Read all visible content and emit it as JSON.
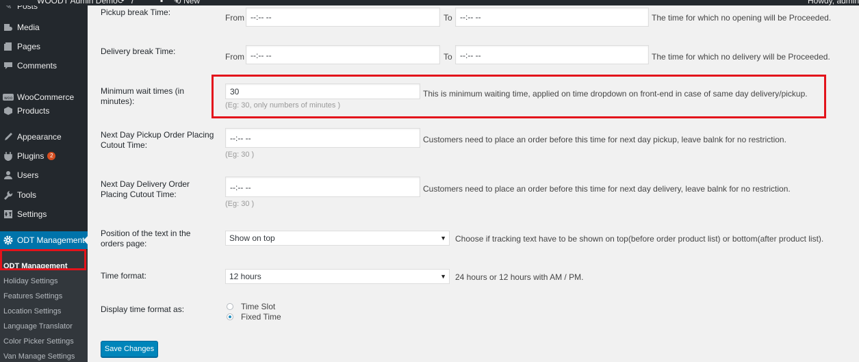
{
  "adminbar": {
    "site_name": "WOODT Admin Demo",
    "updates_count": "7",
    "comments_count": "0",
    "new_label": "New",
    "howdy": "Howdy, admin"
  },
  "sidebar": {
    "items": [
      {
        "label": "Posts",
        "icon": "pin-icon"
      },
      {
        "label": "Media",
        "icon": "media-icon"
      },
      {
        "label": "Pages",
        "icon": "pages-icon"
      },
      {
        "label": "Comments",
        "icon": "comments-icon"
      },
      {
        "label": "WooCommerce",
        "icon": "woocommerce-icon"
      },
      {
        "label": "Products",
        "icon": "products-icon"
      },
      {
        "label": "Appearance",
        "icon": "appearance-icon"
      },
      {
        "label": "Plugins",
        "icon": "plugins-icon",
        "badge": "2"
      },
      {
        "label": "Users",
        "icon": "users-icon"
      },
      {
        "label": "Tools",
        "icon": "tools-icon"
      },
      {
        "label": "Settings",
        "icon": "settings-icon"
      },
      {
        "label": "ODT Management",
        "icon": "gear-icon",
        "active": true
      }
    ],
    "submenu": [
      "ODT Management",
      "Holiday Settings",
      "Features Settings",
      "Location Settings",
      "Language Translator",
      "Color Picker Settings",
      "Van Manage Settings"
    ]
  },
  "form": {
    "pickup_break": {
      "label": "Pickup break Time:",
      "from_label": "From",
      "to_label": "To",
      "from_value": "--:-- --",
      "to_value": "--:-- --",
      "desc": "The time for which no opening will be Proceeded."
    },
    "delivery_break": {
      "label": "Delivery break Time:",
      "from_label": "From",
      "to_label": "To",
      "from_value": "--:-- --",
      "to_value": "--:-- --",
      "desc": "The time for which no delivery will be Proceeded."
    },
    "min_wait": {
      "label": "Minimum wait times (in minutes):",
      "value": "30",
      "desc": "This is minimum waiting time, applied on time dropdown on front-end in case of same day delivery/pickup.",
      "hint": "(Eg: 30, only numbers of minutes )"
    },
    "next_day_pickup": {
      "label": "Next Day Pickup Order Placing Cutout Time:",
      "value": "--:-- --",
      "desc": "Customers need to place an order before this time for next day pickup, leave balnk for no restriction.",
      "hint": "(Eg: 30 )"
    },
    "next_day_delivery": {
      "label": "Next Day Delivery Order Placing Cutout Time:",
      "value": "--:-- --",
      "desc": "Customers need to place an order before this time for next day delivery, leave balnk for no restriction.",
      "hint": "(Eg: 30 )"
    },
    "text_position": {
      "label": "Position of the text in the orders page:",
      "value": "Show on top",
      "desc": "Choose if tracking text have to be shown on top(before order product list) or bottom(after product list)."
    },
    "time_format": {
      "label": "Time format:",
      "value": "12 hours",
      "desc": "24 hours or 12 hours with AM / PM."
    },
    "display_format": {
      "label": "Display time format as:",
      "options": [
        "Time Slot",
        "Fixed Time"
      ],
      "selected": "Fixed Time"
    },
    "save_label": "Save Changes"
  },
  "colors": {
    "admin_dark": "#23282d",
    "submenu_bg": "#32373c",
    "active_blue": "#0073aa",
    "primary_button": "#0085ba",
    "highlight_red": "#e3131b"
  }
}
